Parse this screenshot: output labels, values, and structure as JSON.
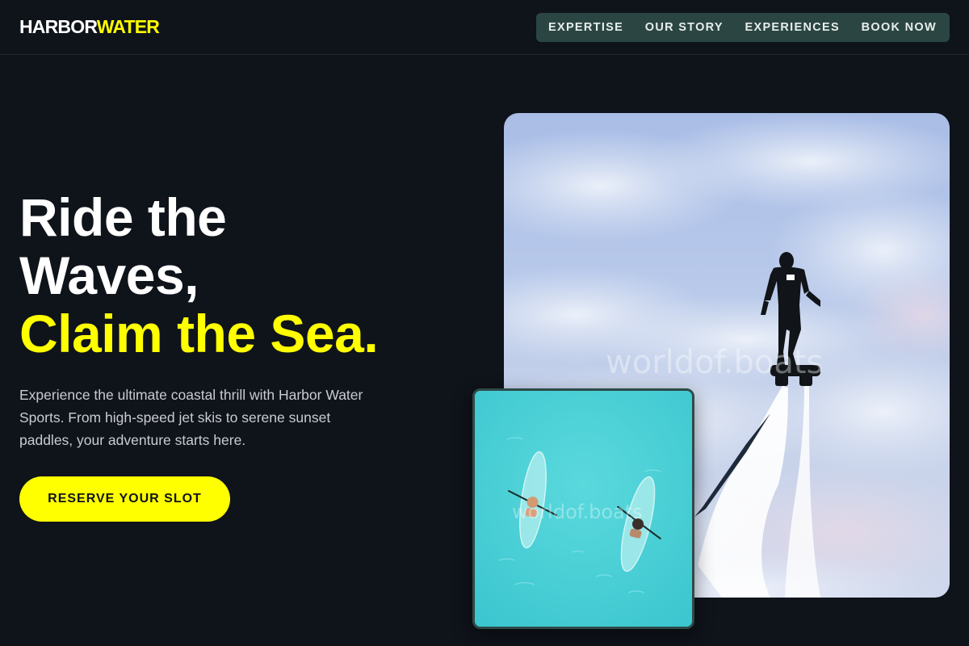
{
  "brand": {
    "name_part1": "HARBOR",
    "name_part2": "WATER"
  },
  "nav": {
    "items": [
      "EXPERTISE",
      "OUR STORY",
      "EXPERIENCES",
      "BOOK NOW"
    ]
  },
  "hero": {
    "headline_line1": "Ride the",
    "headline_line2": "Waves,",
    "headline_accent": "Claim the Sea.",
    "description": "Experience the ultimate coastal thrill with Harbor Water Sports. From high-speed jet skis to serene sunset paddles, your adventure starts here.",
    "cta_label": "RESERVE YOUR SLOT"
  },
  "images": {
    "main_watermark": "worldof.boats",
    "inset_watermark": "worldof.boats"
  },
  "colors": {
    "background": "#0f131a",
    "accent": "#ffff00",
    "nav_background": "#2b4642",
    "inset_water": "#4fd2d8"
  }
}
